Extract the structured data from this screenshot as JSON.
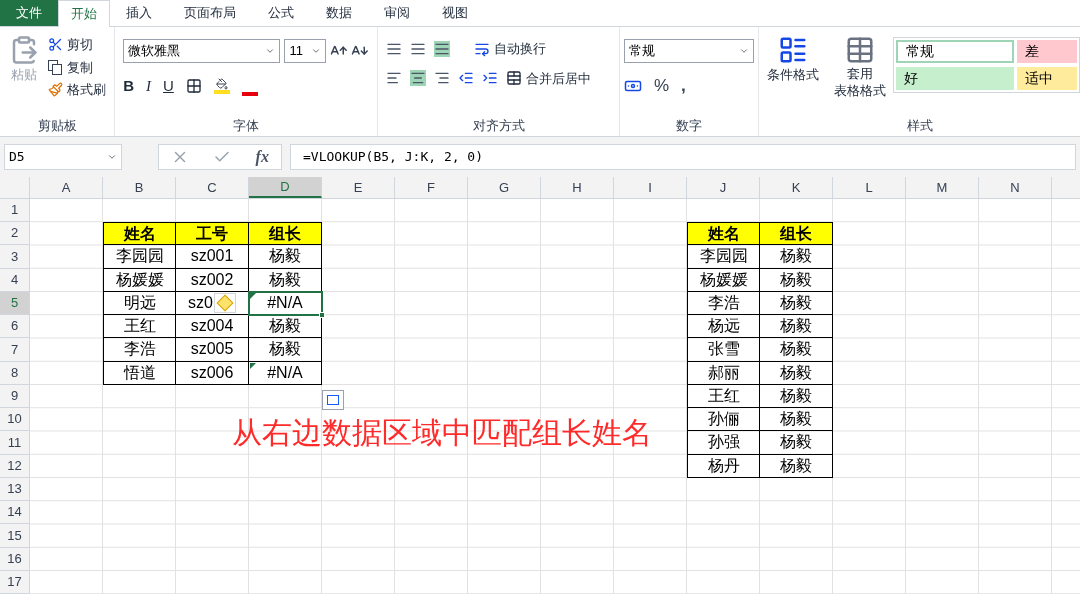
{
  "ribbon_tabs": [
    {
      "label": "文件",
      "kind": "file",
      "selected": false
    },
    {
      "label": "开始",
      "kind": "tab",
      "selected": true
    },
    {
      "label": "插入",
      "kind": "tab",
      "selected": false
    },
    {
      "label": "页面布局",
      "kind": "tab",
      "selected": false
    },
    {
      "label": "公式",
      "kind": "tab",
      "selected": false
    },
    {
      "label": "数据",
      "kind": "tab",
      "selected": false
    },
    {
      "label": "审阅",
      "kind": "tab",
      "selected": false
    },
    {
      "label": "视图",
      "kind": "tab",
      "selected": false
    }
  ],
  "clipboard": {
    "paste": "粘贴",
    "cut": "剪切",
    "copy": "复制",
    "format_painter": "格式刷",
    "label": "剪贴板"
  },
  "font": {
    "name": "微软雅黑",
    "size": "11",
    "bold": "B",
    "italic": "I",
    "underline": "U",
    "label": "字体"
  },
  "alignment": {
    "wrap": "自动换行",
    "merge": "合并后居中",
    "label": "对齐方式"
  },
  "number": {
    "format": "常规",
    "percent": "%",
    "comma": ",",
    "label": "数字"
  },
  "styles": {
    "conditional": "条件格式",
    "table_format_1": "套用",
    "table_format_2": "表格格式",
    "label": "样式",
    "gallery": [
      {
        "label": "常规",
        "color": "#ffffff"
      },
      {
        "label": "差",
        "color": "#ffc7ce"
      },
      {
        "label": "好",
        "color": "#c6efce"
      },
      {
        "label": "适中",
        "color": "#ffeb9c"
      }
    ]
  },
  "formula_bar": {
    "name_box": "D5",
    "fx_label": "fx",
    "formula": "=VLOOKUP(B5, J:K, 2, 0)"
  },
  "columns": [
    {
      "label": "A",
      "selected": false
    },
    {
      "label": "B",
      "selected": false
    },
    {
      "label": "C",
      "selected": false
    },
    {
      "label": "D",
      "selected": true
    },
    {
      "label": "E",
      "selected": false
    },
    {
      "label": "F",
      "selected": false
    },
    {
      "label": "G",
      "selected": false
    },
    {
      "label": "H",
      "selected": false
    },
    {
      "label": "I",
      "selected": false
    },
    {
      "label": "J",
      "selected": false
    },
    {
      "label": "K",
      "selected": false
    },
    {
      "label": "L",
      "selected": false
    },
    {
      "label": "M",
      "selected": false
    },
    {
      "label": "N",
      "selected": false
    }
  ],
  "rows": [
    {
      "label": "1",
      "selected": false
    },
    {
      "label": "2",
      "selected": false
    },
    {
      "label": "3",
      "selected": false
    },
    {
      "label": "4",
      "selected": false
    },
    {
      "label": "5",
      "selected": true
    },
    {
      "label": "6",
      "selected": false
    },
    {
      "label": "7",
      "selected": false
    },
    {
      "label": "8",
      "selected": false
    },
    {
      "label": "9",
      "selected": false
    },
    {
      "label": "10",
      "selected": false
    },
    {
      "label": "11",
      "selected": false
    },
    {
      "label": "12",
      "selected": false
    },
    {
      "label": "13",
      "selected": false
    },
    {
      "label": "14",
      "selected": false
    },
    {
      "label": "15",
      "selected": false
    },
    {
      "label": "16",
      "selected": false
    },
    {
      "label": "17",
      "selected": false
    }
  ],
  "left_table": {
    "headers": [
      "姓名",
      "工号",
      "组长"
    ],
    "rows": [
      {
        "name": "李园园",
        "id": "sz001",
        "leader": "杨毅",
        "warning": false,
        "error_flag": false,
        "selected": false
      },
      {
        "name": "杨媛媛",
        "id": "sz002",
        "leader": "杨毅",
        "warning": false,
        "error_flag": false,
        "selected": false
      },
      {
        "name": "明远",
        "id": "sz0",
        "leader": "#N/A",
        "warning": true,
        "error_flag": true,
        "selected": true
      },
      {
        "name": "王红",
        "id": "sz004",
        "leader": "杨毅",
        "warning": false,
        "error_flag": false,
        "selected": false
      },
      {
        "name": "李浩",
        "id": "sz005",
        "leader": "杨毅",
        "warning": false,
        "error_flag": false,
        "selected": false
      },
      {
        "name": "悟道",
        "id": "sz006",
        "leader": "#N/A",
        "warning": false,
        "error_flag": true,
        "selected": false
      }
    ]
  },
  "right_table": {
    "headers": [
      "姓名",
      "组长"
    ],
    "rows": [
      [
        "李园园",
        "杨毅"
      ],
      [
        "杨媛媛",
        "杨毅"
      ],
      [
        "李浩",
        "杨毅"
      ],
      [
        "杨远",
        "杨毅"
      ],
      [
        "张雪",
        "杨毅"
      ],
      [
        "郝丽",
        "杨毅"
      ],
      [
        "王红",
        "杨毅"
      ],
      [
        "孙俪",
        "杨毅"
      ],
      [
        "孙强",
        "杨毅"
      ],
      [
        "杨丹",
        "杨毅"
      ]
    ]
  },
  "annotation": "从右边数据区域中匹配组长姓名"
}
